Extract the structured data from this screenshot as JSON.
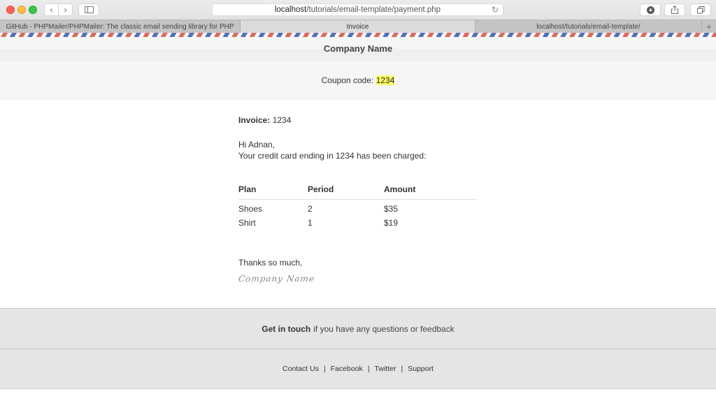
{
  "browser": {
    "url_host": "localhost",
    "url_path": "/tutorials/email-template/payment.php",
    "tabs": [
      {
        "label": "GitHub - PHPMailer/PHPMailer: The classic email sending library for PHP",
        "active": false
      },
      {
        "label": "Invoice",
        "active": true
      },
      {
        "label": "localhost/tutorials/email-template/",
        "active": false
      }
    ],
    "new_tab_label": "+"
  },
  "email": {
    "company_name": "Company Name",
    "coupon_label": "Coupon code:",
    "coupon_code": "1234",
    "invoice_label": "Invoice:",
    "invoice_number": "1234",
    "greeting": "Hi Adnan,",
    "message": "Your credit card ending in 1234 has been charged:",
    "table": {
      "headers": [
        "Plan",
        "Period",
        "Amount"
      ],
      "rows": [
        [
          "Shoes",
          "2",
          "$35"
        ],
        [
          "Shirt",
          "1",
          "$19"
        ]
      ]
    },
    "thanks": "Thanks so much,",
    "signature": "Company Name"
  },
  "footer": {
    "touch_bold": "Get in touch",
    "touch_text": "if you have any questions or feedback",
    "links": [
      "Contact Us",
      "Facebook",
      "Twitter",
      "Support"
    ],
    "separator": "|"
  },
  "colors": {
    "stripe_red": "#dc6a5c",
    "stripe_blue": "#5670b8",
    "highlight": "#ffff66"
  }
}
